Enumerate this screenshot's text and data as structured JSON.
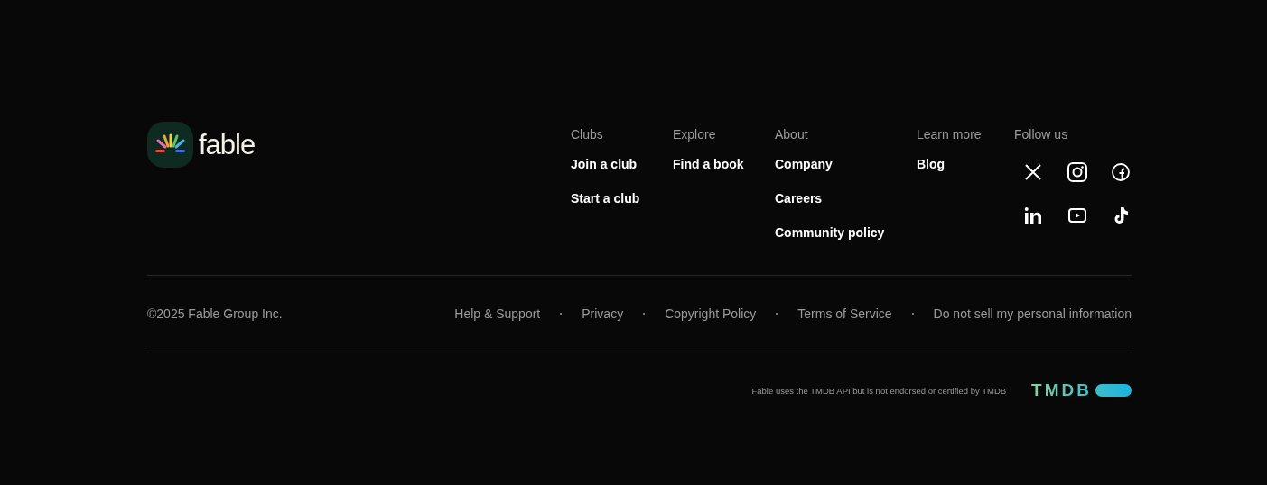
{
  "brand": {
    "name": "fable"
  },
  "columns": [
    {
      "heading": "Clubs",
      "links": [
        "Join a club",
        "Start a club"
      ]
    },
    {
      "heading": "Explore",
      "links": [
        "Find a book"
      ]
    },
    {
      "heading": "About",
      "links": [
        "Company",
        "Careers",
        "Community policy"
      ]
    },
    {
      "heading": "Learn more",
      "links": [
        "Blog"
      ]
    }
  ],
  "social": {
    "heading": "Follow us",
    "icons": [
      {
        "kind": "x"
      },
      {
        "kind": "camera"
      },
      {
        "kind": "f"
      },
      {
        "kind": "in"
      },
      {
        "kind": "play"
      },
      {
        "kind": "note"
      }
    ]
  },
  "bottom": {
    "copyright": "©2025 Fable Group Inc.",
    "links": [
      "Help & Support",
      "Privacy",
      "Copyright Policy",
      "Terms of Service",
      "Do not sell my personal information"
    ]
  },
  "attribution": {
    "text": "Fable uses the TMDB API but is not endorsed or certified by TMDB",
    "logo": "TMDB"
  }
}
